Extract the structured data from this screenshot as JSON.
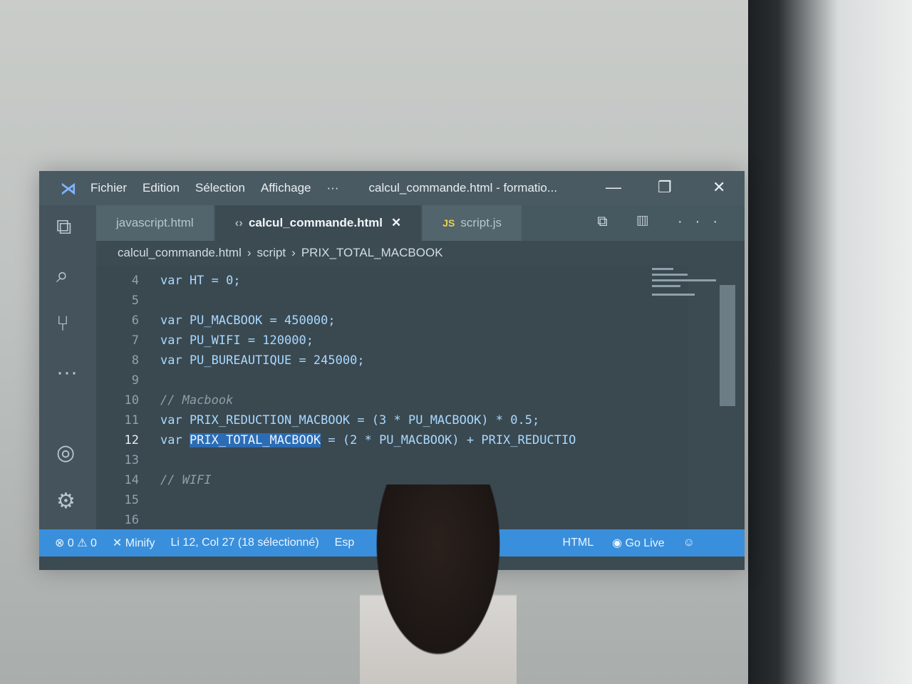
{
  "window": {
    "title": "calcul_commande.html - formatio...",
    "menu": [
      "Fichier",
      "Edition",
      "Sélection",
      "Affichage",
      "···"
    ],
    "controls": {
      "minimize": "—",
      "restore": "❐",
      "close": "✕"
    }
  },
  "tabs": [
    {
      "label": "javascript.html",
      "icon": "html-file-icon",
      "active": false
    },
    {
      "label": "calcul_commande.html",
      "icon": "html-file-icon",
      "active": true,
      "close": "✕"
    },
    {
      "label": "script.js",
      "icon": "js-file-icon",
      "badge": "JS",
      "active": false
    }
  ],
  "tab_actions": "⧉ ▥ ···",
  "breadcrumb": {
    "file": "calcul_commande.html",
    "sep1": "›",
    "script": "script",
    "sep2": "›",
    "symbol": "PRIX_TOTAL_MACBOOK"
  },
  "code_lines": [
    {
      "num": "4",
      "text": "var HT = 0;"
    },
    {
      "num": "5",
      "text": ""
    },
    {
      "num": "6",
      "text": "var PU_MACBOOK = 450000;"
    },
    {
      "num": "7",
      "text": "var PU_WIFI = 120000;"
    },
    {
      "num": "8",
      "text": "var PU_BUREAUTIQUE = 245000;"
    },
    {
      "num": "9",
      "text": ""
    },
    {
      "num": "10",
      "text": "// Macbook"
    },
    {
      "num": "11",
      "text": "var PRIX_REDUCTION_MACBOOK = (3 * PU_MACBOOK) * 0.5;"
    },
    {
      "num": "12",
      "text_before": "var ",
      "selected": "PRIX_TOTAL_MACBOOK",
      "text_after": " = (2 * PU_MACBOOK) + PRIX_REDUCTIO"
    },
    {
      "num": "13",
      "text": ""
    },
    {
      "num": "14",
      "text": "// WIFI"
    },
    {
      "num": "15",
      "text": ""
    },
    {
      "num": "16",
      "text": ""
    }
  ],
  "statusbar": {
    "problems": "⊗ 0 ⚠ 0",
    "minify": "✕ Minify",
    "position": "Li 12, Col 27 (18 sélectionné)",
    "encoding": "Esp",
    "language": "HTML",
    "golive": "Go Live"
  },
  "colors": {
    "statusbar": "#3a8fdc",
    "editor_bg": "#3a4850",
    "selection": "#2b6cb5"
  }
}
